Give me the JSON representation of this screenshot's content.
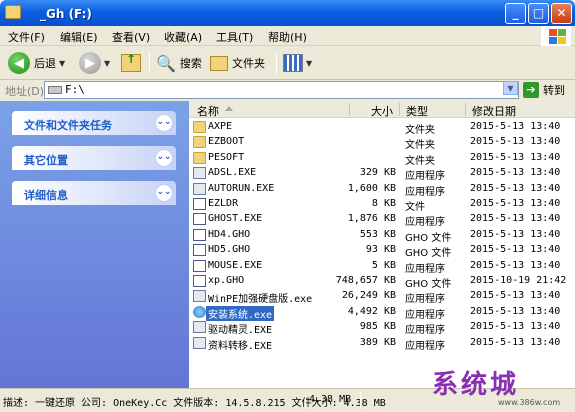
{
  "window": {
    "title": "　_Gh (F:)"
  },
  "menu": [
    "文件(F)",
    "编辑(E)",
    "查看(V)",
    "收藏(A)",
    "工具(T)",
    "帮助(H)"
  ],
  "toolbar": {
    "back": "后退",
    "search": "搜索",
    "folders": "文件夹"
  },
  "address": {
    "label": "地址(D)",
    "value": "F:\\",
    "go": "转到"
  },
  "tasks": {
    "items": [
      "文件和文件夹任务",
      "其它位置",
      "详细信息"
    ]
  },
  "columns": {
    "name": "名称",
    "size": "大小",
    "type": "类型",
    "date": "修改日期"
  },
  "files": [
    {
      "name": "AXPE",
      "size": "",
      "type": "文件夹",
      "date": "2015-5-13 13:40",
      "icon": "folder"
    },
    {
      "name": "EZBOOT",
      "size": "",
      "type": "文件夹",
      "date": "2015-5-13 13:40",
      "icon": "folder"
    },
    {
      "name": "PESOFT",
      "size": "",
      "type": "文件夹",
      "date": "2015-5-13 13:40",
      "icon": "folder"
    },
    {
      "name": "ADSL.EXE",
      "size": "329 KB",
      "type": "应用程序",
      "date": "2015-5-13 13:40",
      "icon": "exe"
    },
    {
      "name": "AUTORUN.EXE",
      "size": "1,600 KB",
      "type": "应用程序",
      "date": "2015-5-13 13:40",
      "icon": "exe"
    },
    {
      "name": "EZLDR",
      "size": "8 KB",
      "type": "文件",
      "date": "2015-5-13 13:40",
      "icon": "gho"
    },
    {
      "name": "GHOST.EXE",
      "size": "1,876 KB",
      "type": "应用程序",
      "date": "2015-5-13 13:40",
      "icon": "gho"
    },
    {
      "name": "HD4.GHO",
      "size": "553 KB",
      "type": "GHO 文件",
      "date": "2015-5-13 13:40",
      "icon": "gho"
    },
    {
      "name": "HD5.GHO",
      "size": "93 KB",
      "type": "GHO 文件",
      "date": "2015-5-13 13:40",
      "icon": "gho"
    },
    {
      "name": "MOUSE.EXE",
      "size": "5 KB",
      "type": "应用程序",
      "date": "2015-5-13 13:40",
      "icon": "gho"
    },
    {
      "name": "xp.GHO",
      "size": "748,657 KB",
      "type": "GHO 文件",
      "date": "2015-10-19 21:42",
      "icon": "gho"
    },
    {
      "name": "WinPE加强硬盘版.exe",
      "size": "26,249 KB",
      "type": "应用程序",
      "date": "2015-5-13 13:40",
      "icon": "exe"
    },
    {
      "name": "安装系统.exe",
      "size": "4,492 KB",
      "type": "应用程序",
      "date": "2015-5-13 13:40",
      "icon": "setup",
      "selected": true
    },
    {
      "name": "驱动精灵.EXE",
      "size": "985 KB",
      "type": "应用程序",
      "date": "2015-5-13 13:40",
      "icon": "exe"
    },
    {
      "name": "资料转移.EXE",
      "size": "389 KB",
      "type": "应用程序",
      "date": "2015-5-13 13:40",
      "icon": "exe"
    }
  ],
  "status": {
    "description": "描述: 一键还原 公司: OneKey.Cc 文件版本: 14.5.8.215 文件大小: 4.38 MB",
    "size": "4.38 MB"
  },
  "watermark": {
    "brand": "系统城",
    "url": "www.386w.com"
  },
  "colors": {
    "titlebar": "#0a5fe0",
    "taskpane": "#7ba2e7",
    "selection": "#316ac5"
  }
}
